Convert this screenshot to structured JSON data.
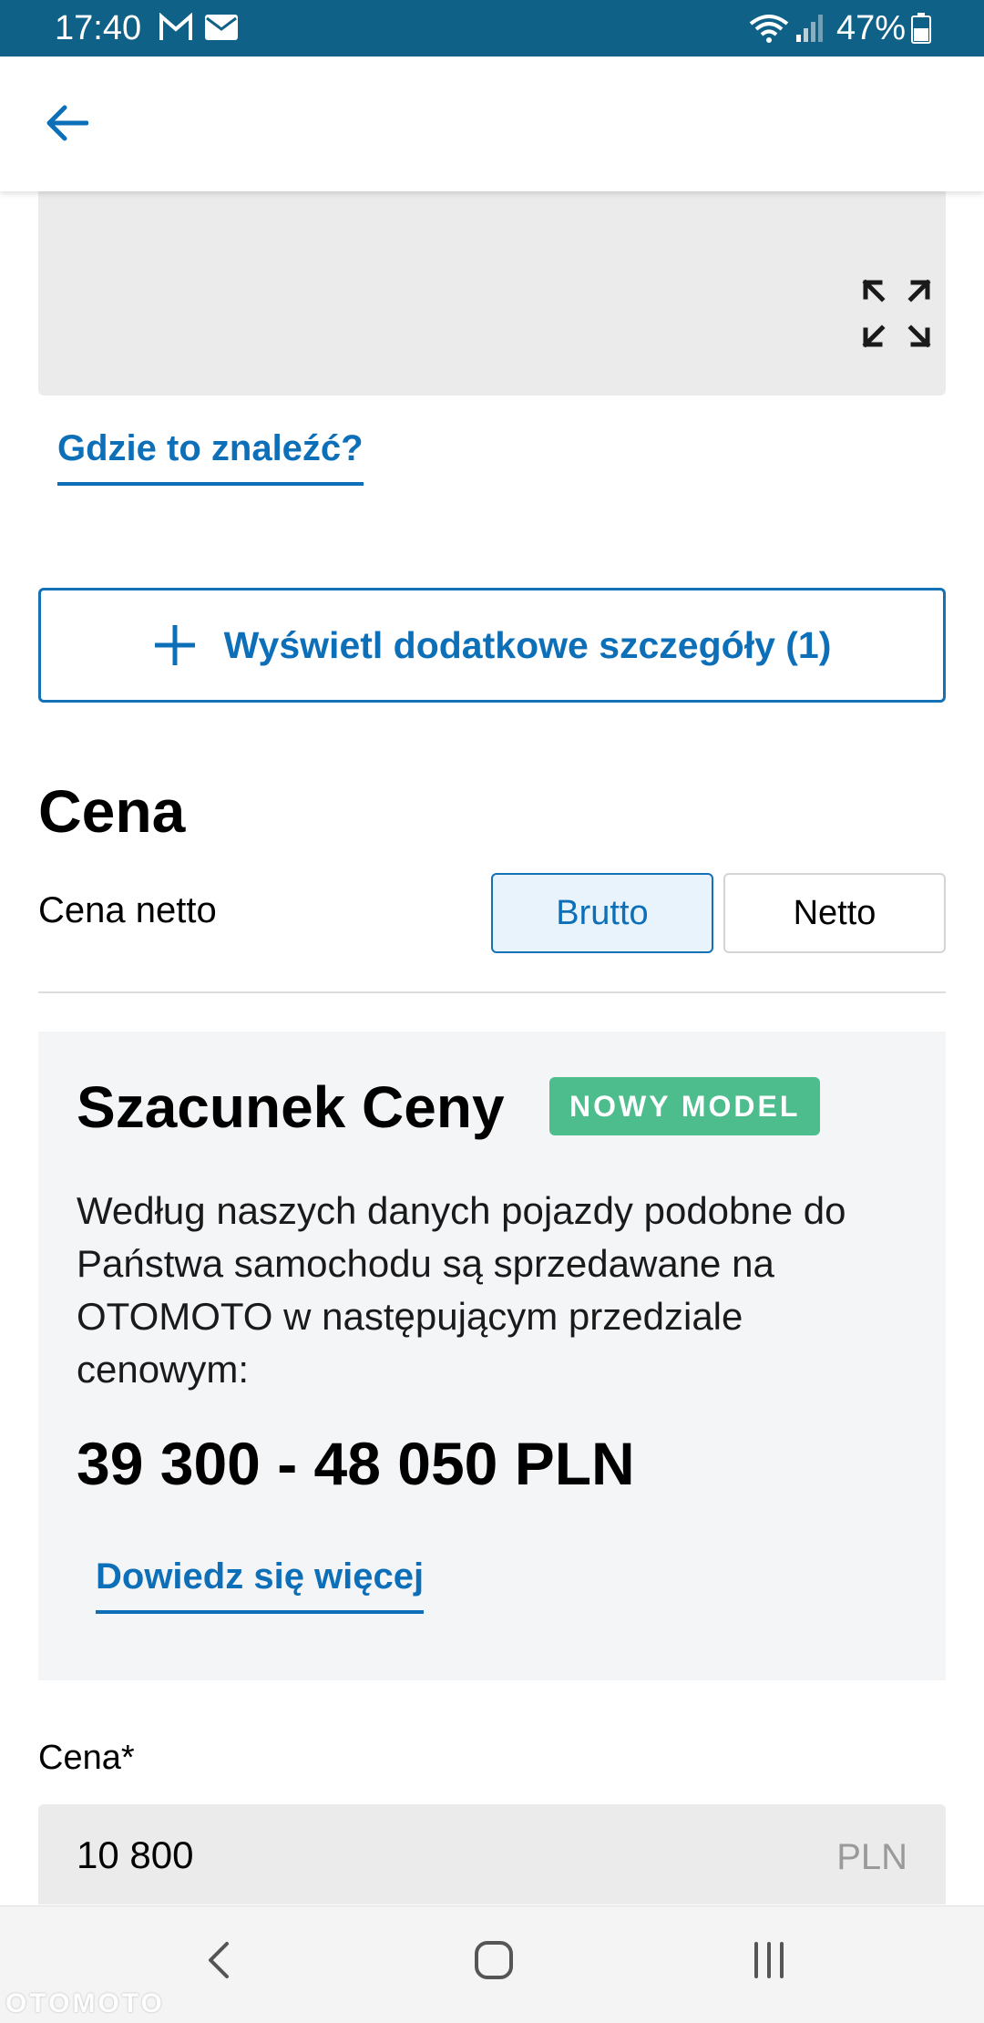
{
  "status_bar": {
    "time": "17:40",
    "battery": "47%",
    "icons": [
      "gmail-icon",
      "mail-icon",
      "wifi-icon",
      "signal-icon",
      "battery-icon"
    ]
  },
  "app_bar": {
    "back_icon": "arrow-left-icon"
  },
  "image_section": {
    "expand_icon": "expand-icon",
    "help_link": "Gdzie to znaleźć?"
  },
  "details_button": {
    "label": "Wyświetl dodatkowe szczegóły (1)",
    "icon": "plus-icon"
  },
  "price_section": {
    "title": "Cena",
    "net_label": "Cena netto",
    "toggle_options": [
      "Brutto",
      "Netto"
    ],
    "selected": "Brutto"
  },
  "estimate": {
    "title": "Szacunek Ceny",
    "badge": "NOWY MODEL",
    "description": "Według naszych danych pojazdy podobne do Państwa samochodu są sprzedawane na OTOMOTO w następującym przedziale cenowym:",
    "range": "39 300 - 48 050 PLN",
    "learn_more": "Dowiedz się więcej"
  },
  "price_field": {
    "label": "Cena*",
    "value": "10 800",
    "unit": "PLN"
  },
  "nav_bar": {
    "buttons": [
      "back-nav-icon",
      "home-nav-icon",
      "recents-nav-icon"
    ]
  },
  "watermark": "OTOMOTO",
  "colors": {
    "status_bar": "#0f6188",
    "accent": "#0d6fb8",
    "badge": "#4dbd8e",
    "card_bg": "#f4f5f7",
    "input_bg": "#ebebeb"
  }
}
